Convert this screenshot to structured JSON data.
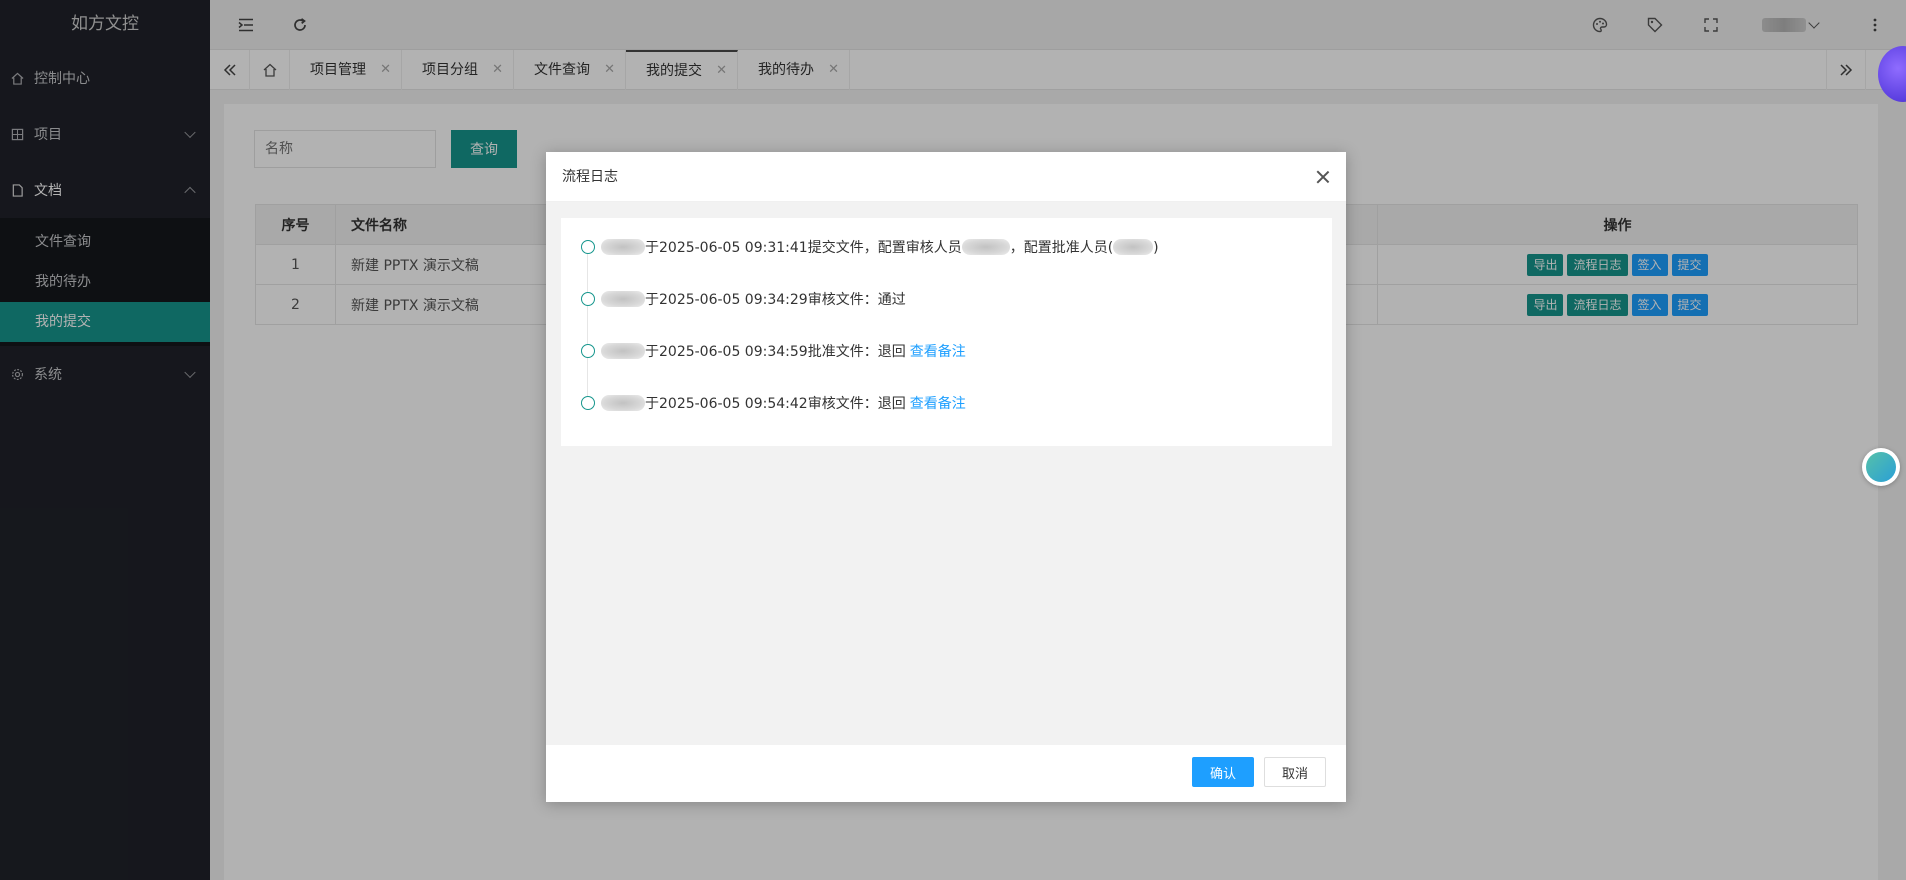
{
  "app": {
    "title": "如方文控"
  },
  "sidebar": {
    "items": [
      {
        "label": "控制中心",
        "icon": "home-icon"
      },
      {
        "label": "项目",
        "icon": "project-icon"
      },
      {
        "label": "文档",
        "icon": "document-icon"
      },
      {
        "label": "系统",
        "icon": "settings-icon"
      }
    ],
    "doc_sub": [
      {
        "label": "文件查询"
      },
      {
        "label": "我的待办"
      },
      {
        "label": "我的提交"
      }
    ]
  },
  "tabs": [
    {
      "label": "项目管理"
    },
    {
      "label": "项目分组"
    },
    {
      "label": "文件查询"
    },
    {
      "label": "我的提交"
    },
    {
      "label": "我的待办"
    }
  ],
  "search": {
    "placeholder": "名称",
    "button": "查询"
  },
  "table": {
    "headers": {
      "index": "序号",
      "name": "文件名称",
      "ops": "操作"
    },
    "rows": [
      {
        "index": "1",
        "name": "新建 PPTX 演示文稿"
      },
      {
        "index": "2",
        "name": "新建 PPTX 演示文稿"
      }
    ],
    "op_labels": {
      "export": "导出",
      "log": "流程日志",
      "checkin": "签入",
      "submit": "提交"
    }
  },
  "modal": {
    "title": "流程日志",
    "logs": [
      {
        "text": "于2025-06-05 09:31:41提交文件，配置审核人员",
        "mid": "，配置批准人员(",
        "end": ")"
      },
      {
        "text": "于2025-06-05 09:34:29审核文件：通过"
      },
      {
        "text": "于2025-06-05 09:34:59批准文件：退回",
        "link": "查看备注"
      },
      {
        "text": "于2025-06-05 09:54:42审核文件：退回",
        "link": "查看备注"
      }
    ],
    "confirm": "确认",
    "cancel": "取消"
  },
  "colors": {
    "accent": "#16968d",
    "primary": "#1e9fff",
    "sidebar_bg": "#20222a"
  }
}
